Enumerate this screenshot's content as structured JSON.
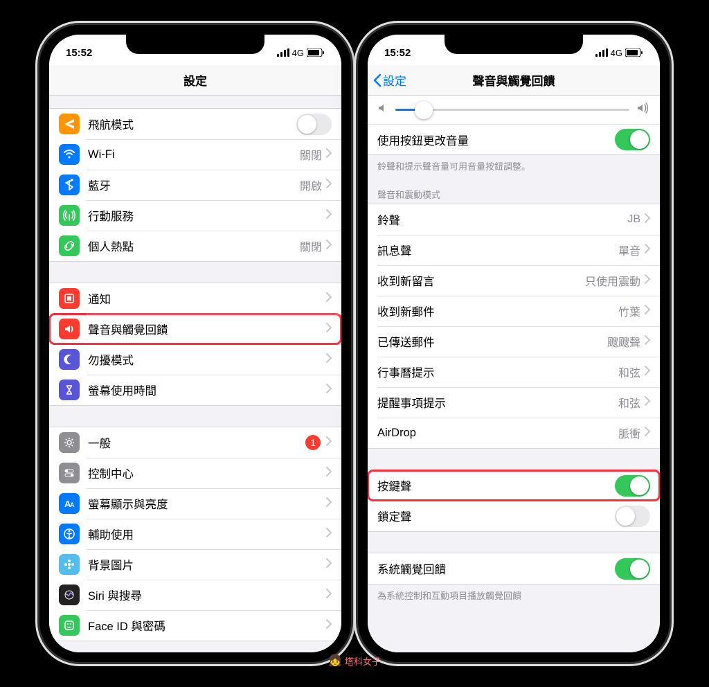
{
  "status": {
    "time": "15:52",
    "network": "4G"
  },
  "left": {
    "title": "設定",
    "group1": [
      {
        "label": "飛航模式",
        "icon": "airplane",
        "bg": "#ff9500",
        "type": "toggle",
        "on": false
      },
      {
        "label": "Wi-Fi",
        "icon": "wifi",
        "bg": "#007aff",
        "value": "關閉"
      },
      {
        "label": "藍牙",
        "icon": "bluetooth",
        "bg": "#007aff",
        "value": "開啟"
      },
      {
        "label": "行動服務",
        "icon": "antenna",
        "bg": "#34c759",
        "value": ""
      },
      {
        "label": "個人熱點",
        "icon": "link",
        "bg": "#34c759",
        "value": "關閉"
      }
    ],
    "group2": [
      {
        "label": "通知",
        "icon": "bell",
        "bg": "#ff3b30"
      },
      {
        "label": "聲音與觸覺回饋",
        "icon": "speaker",
        "bg": "#ff3b30",
        "highlight": true
      },
      {
        "label": "勿擾模式",
        "icon": "moon",
        "bg": "#5856d6"
      },
      {
        "label": "螢幕使用時間",
        "icon": "hourglass",
        "bg": "#5856d6"
      }
    ],
    "group3": [
      {
        "label": "一般",
        "icon": "gear",
        "bg": "#8e8e93",
        "badge": "1"
      },
      {
        "label": "控制中心",
        "icon": "switches",
        "bg": "#8e8e93"
      },
      {
        "label": "螢幕顯示與亮度",
        "icon": "text-size",
        "bg": "#007aff"
      },
      {
        "label": "輔助使用",
        "icon": "accessibility",
        "bg": "#007aff"
      },
      {
        "label": "背景圖片",
        "icon": "flower",
        "bg": "#53bdeb"
      },
      {
        "label": "Siri 與搜尋",
        "icon": "siri",
        "bg": "#222"
      },
      {
        "label": "Face ID 與密碼",
        "icon": "faceid",
        "bg": "#34c759"
      }
    ]
  },
  "right": {
    "back": "設定",
    "title": "聲音與觸覺回饋",
    "slider_percent": 12,
    "volume_buttons": {
      "label": "使用按鈕更改音量",
      "on": true
    },
    "volume_footer": "鈴聲和提示聲音量可用音量按鈕調整。",
    "patterns_header": "聲音和震動模式",
    "patterns": [
      {
        "label": "鈴聲",
        "value": "JB"
      },
      {
        "label": "訊息聲",
        "value": "單音"
      },
      {
        "label": "收到新留言",
        "value": "只使用震動"
      },
      {
        "label": "收到新郵件",
        "value": "竹葉"
      },
      {
        "label": "已傳送郵件",
        "value": "颼颼聲"
      },
      {
        "label": "行事曆提示",
        "value": "和弦"
      },
      {
        "label": "提醒事項提示",
        "value": "和弦"
      },
      {
        "label": "AirDrop",
        "value": "脈衝"
      }
    ],
    "keyboard_clicks": {
      "label": "按鍵聲",
      "on": true,
      "highlight": true
    },
    "lock_sound": {
      "label": "鎖定聲",
      "on": false
    },
    "haptics": {
      "label": "系統觸覺回饋",
      "on": true
    },
    "haptics_footer": "為系統控制和互動項目播放觸覺回饋"
  },
  "watermark": "塔科女子"
}
